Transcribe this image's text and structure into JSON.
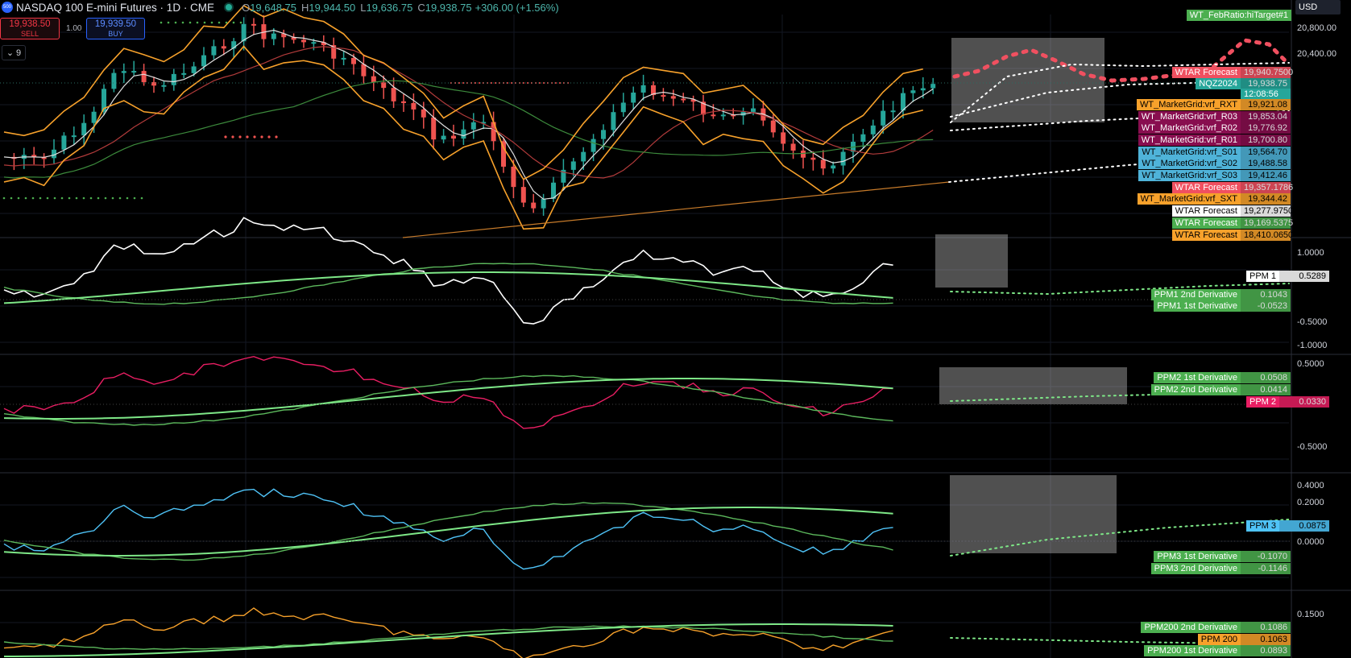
{
  "header": {
    "logo_text": "500",
    "title": "NASDAQ 100 E-mini Futures · 1D · CME",
    "ohlc": [
      {
        "k": "O",
        "v": "19,648.75"
      },
      {
        "k": "H",
        "v": "19,944.50"
      },
      {
        "k": "L",
        "v": "19,636.75"
      },
      {
        "k": "C",
        "v": "19,938.75"
      }
    ],
    "change": "+306.00 (+1.56%)"
  },
  "trade": {
    "sell_price": "19,938.50",
    "sell_label": "SELL",
    "buy_price": "19,939.50",
    "buy_label": "BUY",
    "quantity": "1.00"
  },
  "indicators_toggle": {
    "count": "9",
    "icon": "chevron-down-icon"
  },
  "currency": "USD",
  "colors": {
    "bull": "#26a69a",
    "bear": "#ef5350",
    "band": "#f7a12b",
    "green": "#4caf50",
    "lime": "#7ee787",
    "pink": "#e91e63",
    "blue": "#4fc3f7"
  },
  "price_scale": [
    "20,800.00",
    "20,400.00"
  ],
  "price_labels": [
    {
      "name": "WT_FebRatio:hiTarget#1",
      "value": "",
      "color": "#4caf50",
      "text": "#fff"
    },
    {
      "name": "WTAR Forecast",
      "value": "19,940.7500",
      "color": "#f05060",
      "text": "#fff"
    },
    {
      "name": "NQZ2024",
      "value": "19,938.75",
      "value2": "12:08:56",
      "color": "#26a69a",
      "text": "#fff"
    },
    {
      "name": "WT_MarketGrid:vrf_RXT",
      "value": "19,921.08",
      "color": "#f7a12b",
      "text": "#000"
    },
    {
      "name": "WT_MarketGrid:vrf_R03",
      "value": "19,853.04",
      "color": "#880e4f",
      "text": "#fff"
    },
    {
      "name": "WT_MarketGrid:vrf_R02",
      "value": "19,776.92",
      "color": "#880e4f",
      "text": "#fff"
    },
    {
      "name": "WT_MarketGrid:vrf_R01",
      "value": "19,700.80",
      "color": "#880e4f",
      "text": "#fff"
    },
    {
      "name": "WT_MarketGrid:vrf_S01",
      "value": "19,564.70",
      "color": "#4fb3d9",
      "text": "#000"
    },
    {
      "name": "WT_MarketGrid:vrf_S02",
      "value": "19,488.58",
      "color": "#4fb3d9",
      "text": "#000"
    },
    {
      "name": "WT_MarketGrid:vrf_S03",
      "value": "19,412.46",
      "color": "#4fb3d9",
      "text": "#000"
    },
    {
      "name": "WTAR Forecast",
      "value": "19,357.1786",
      "color": "#f05060",
      "text": "#fff"
    },
    {
      "name": "WT_MarketGrid:vrf_SXT",
      "value": "19,344.42",
      "color": "#f7a12b",
      "text": "#000"
    },
    {
      "name": "WTAR Forecast",
      "value": "19,277.9750",
      "color": "#ffffff",
      "text": "#000"
    },
    {
      "name": "WTAR Forecast",
      "value": "19,169.5375",
      "color": "#4caf50",
      "text": "#fff"
    },
    {
      "name": "WTAR Forecast",
      "value": "18,410.0650",
      "color": "#f7a12b",
      "text": "#000"
    }
  ],
  "panes": [
    {
      "id": "ppm1",
      "scale": [
        "1.0000",
        "-0.5000",
        "-1.0000"
      ],
      "labels": [
        {
          "name": "PPM 1",
          "value": "0.5289",
          "color": "#ffffff",
          "text": "#000"
        },
        {
          "name": "PPM1 2nd Derivative",
          "value": "0.1043",
          "color": "#4caf50",
          "text": "#fff"
        },
        {
          "name": "PPM1 1st Derivative",
          "value": "-0.0523",
          "color": "#4caf50",
          "text": "#fff"
        }
      ]
    },
    {
      "id": "ppm2",
      "scale": [
        "0.5000",
        "-0.5000"
      ],
      "labels": [
        {
          "name": "PPM2 1st Derivative",
          "value": "0.0508",
          "color": "#4caf50",
          "text": "#fff"
        },
        {
          "name": "PPM2 2nd Derivative",
          "value": "0.0414",
          "color": "#4caf50",
          "text": "#fff"
        },
        {
          "name": "PPM 2",
          "value": "0.0330",
          "color": "#e91e63",
          "text": "#fff"
        }
      ]
    },
    {
      "id": "ppm3",
      "scale": [
        "0.4000",
        "0.2000",
        "0.0000"
      ],
      "labels": [
        {
          "name": "PPM 3",
          "value": "0.0875",
          "color": "#4fc3f7",
          "text": "#000"
        },
        {
          "name": "PPM3 1st Derivative",
          "value": "-0.1070",
          "color": "#4caf50",
          "text": "#fff"
        },
        {
          "name": "PPM3 2nd Derivative",
          "value": "-0.1146",
          "color": "#4caf50",
          "text": "#fff"
        }
      ]
    },
    {
      "id": "ppm200",
      "scale": [
        "0.1500"
      ],
      "labels": [
        {
          "name": "PPM200 2nd Derivative",
          "value": "0.1086",
          "color": "#4caf50",
          "text": "#fff"
        },
        {
          "name": "PPM 200",
          "value": "0.1063",
          "color": "#f7a12b",
          "text": "#000"
        },
        {
          "name": "PPM200 1st Derivative",
          "value": "0.0893",
          "color": "#4caf50",
          "text": "#fff"
        }
      ]
    }
  ]
}
